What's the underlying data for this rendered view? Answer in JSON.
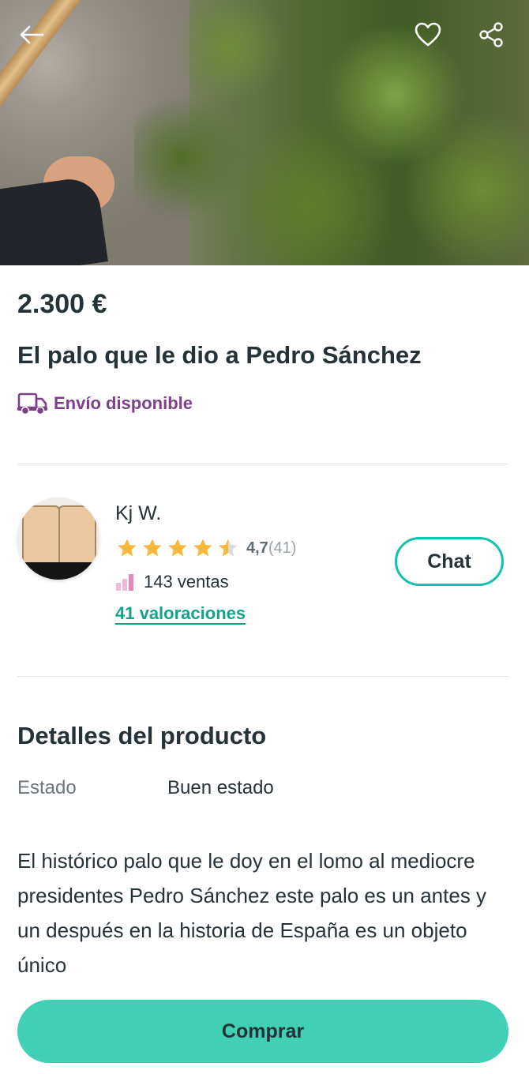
{
  "header": {
    "back_icon": "arrow-left-icon",
    "favorite_icon": "heart-icon",
    "share_icon": "share-icon"
  },
  "product": {
    "price": "2.300 €",
    "title": "El palo que le dio a Pedro Sánchez",
    "shipping_label": "Envío disponible",
    "shipping_icon": "truck-icon"
  },
  "seller": {
    "name": "Kj W.",
    "rating_value": "4,7",
    "rating_count": "(41)",
    "stars": 4.5,
    "sales": "143 ventas",
    "reviews_link": "41 valoraciones",
    "chat_label": "Chat"
  },
  "details": {
    "section_title": "Detalles del producto",
    "condition_label": "Estado",
    "condition_value": "Buen estado",
    "description": "El histórico palo que le doy en el lomo al mediocre presidentes Pedro Sánchez este palo es un antes y un después en la historia de España es un objeto único"
  },
  "actions": {
    "buy_label": "Comprar"
  },
  "colors": {
    "brand": "#13c1ac",
    "buy_button": "#3fd0b6",
    "shipping": "#7d3f8c",
    "star": "#f6b73c",
    "text": "#253238"
  }
}
